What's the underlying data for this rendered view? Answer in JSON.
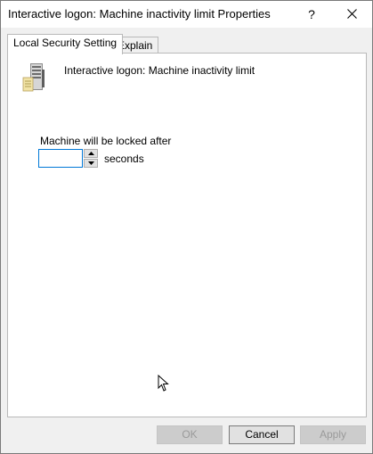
{
  "window": {
    "title": "Interactive logon: Machine inactivity limit Properties",
    "help_label": "?",
    "close_icon": "close-icon"
  },
  "tabs": [
    {
      "label": "Local Security Setting",
      "active": true
    },
    {
      "label": "Explain",
      "active": false
    }
  ],
  "panel": {
    "icon": "server-icon",
    "policy_name": "Interactive logon: Machine inactivity limit",
    "lock_label": "Machine will be locked after",
    "input_value": "",
    "units": "seconds"
  },
  "buttons": {
    "ok": "OK",
    "cancel": "Cancel",
    "apply": "Apply"
  },
  "colors": {
    "focus_border": "#0078d7",
    "dialog_background": "#f0f0f0"
  }
}
